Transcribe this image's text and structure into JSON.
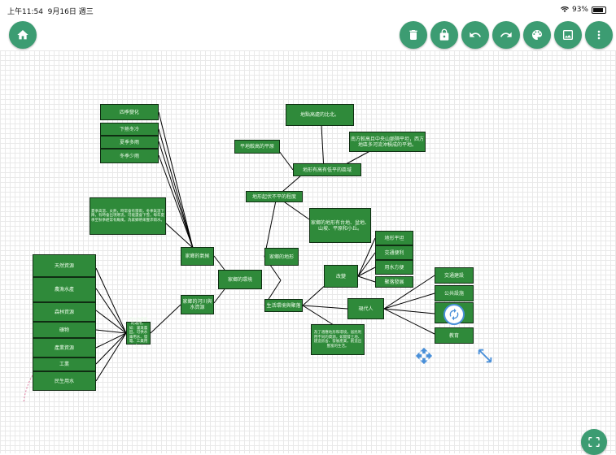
{
  "status_bar": {
    "time": "上午11:54",
    "date": "9月16日 週三",
    "battery": "93%"
  },
  "toolbar": {
    "home": "home-icon",
    "actions": [
      "trash-icon",
      "lock-icon",
      "undo-icon",
      "redo-icon",
      "palette-icon",
      "image-icon",
      "more-vert-icon"
    ]
  },
  "colors": {
    "accent": "#3c9c72",
    "node": "#2f8a3a",
    "selection": "#4a90d9"
  },
  "mindmap": {
    "center": "家鄉的環境",
    "n_season": "四季變化",
    "n_summer": "下熱冬冷",
    "n_rain": "夏季多雨",
    "n_dry": "冬季少雨",
    "n_features": "家鄉的氣候",
    "n_features_desc": "夏季高溫、炎熱，時常會有雷雨，冬季氣溫下降，有時會出現寒流，可能還會下雪，每年夏季至秋季經常有颱風，為家鄉帶來豐沛雨水。",
    "n_seen": "地點高處的比北。",
    "n_south": "平地較高的平原",
    "n_contrast": "南方較高且中央山脈隔平坦，西方地區多河流沖積成的平地。",
    "n_mid": "地形有高有低平的區域",
    "n_terrain": "地形起伏不平的程度",
    "n_land": "家鄉的地形有台地、盆地、山坡、平原和小丘。",
    "n_water": "家鄉的地形",
    "n_river_l": "家鄉的河川與水資源",
    "n_list": [
      "天然資源",
      "農漁水產",
      "森林資源",
      "礦物",
      "產業資源",
      "工業",
      "民生用水"
    ],
    "n_river_desc": "河川水資源的運用，如：灌溉農田，可供水庫用水、發電、工業用水。",
    "n_live": "生活環境與聚落",
    "n_change": "改變",
    "n_change_items": [
      "地形平坦",
      "交通便利",
      "用水方便",
      "聚落發展"
    ],
    "n_modern": "現代人",
    "n_modern_items": [
      "交通建設",
      "公共設施",
      "觀光景點",
      "教育"
    ],
    "n_live_desc": "為了適應地形和環境，居民利用不同的資源，如開發土地、建造房舍、發展產業，創造出豐富的生活。"
  }
}
